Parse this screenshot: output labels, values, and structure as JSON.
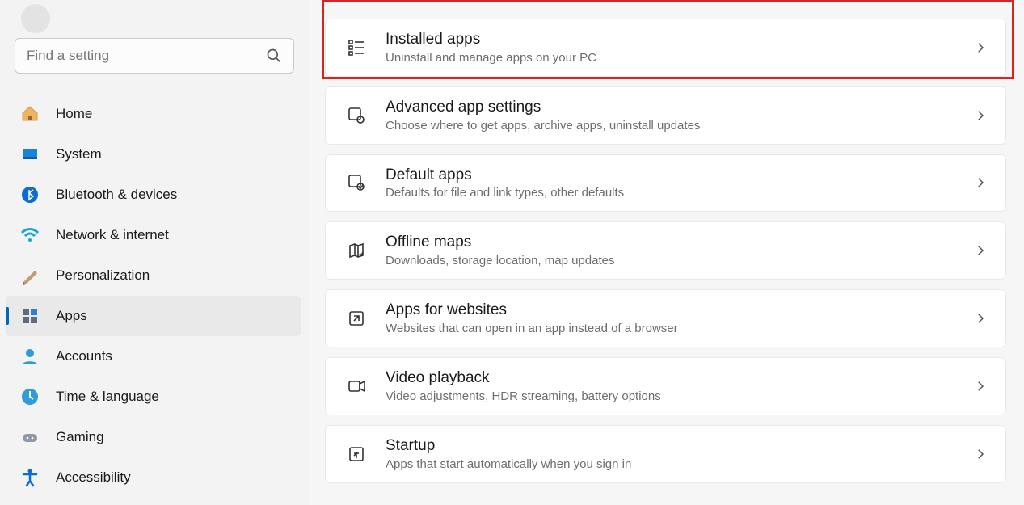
{
  "search": {
    "placeholder": "Find a setting"
  },
  "nav": [
    {
      "label": "Home"
    },
    {
      "label": "System"
    },
    {
      "label": "Bluetooth & devices"
    },
    {
      "label": "Network & internet"
    },
    {
      "label": "Personalization"
    },
    {
      "label": "Apps"
    },
    {
      "label": "Accounts"
    },
    {
      "label": "Time & language"
    },
    {
      "label": "Gaming"
    },
    {
      "label": "Accessibility"
    }
  ],
  "cards": [
    {
      "title": "Installed apps",
      "sub": "Uninstall and manage apps on your PC"
    },
    {
      "title": "Advanced app settings",
      "sub": "Choose where to get apps, archive apps, uninstall updates"
    },
    {
      "title": "Default apps",
      "sub": "Defaults for file and link types, other defaults"
    },
    {
      "title": "Offline maps",
      "sub": "Downloads, storage location, map updates"
    },
    {
      "title": "Apps for websites",
      "sub": "Websites that can open in an app instead of a browser"
    },
    {
      "title": "Video playback",
      "sub": "Video adjustments, HDR streaming, battery options"
    },
    {
      "title": "Startup",
      "sub": "Apps that start automatically when you sign in"
    }
  ]
}
